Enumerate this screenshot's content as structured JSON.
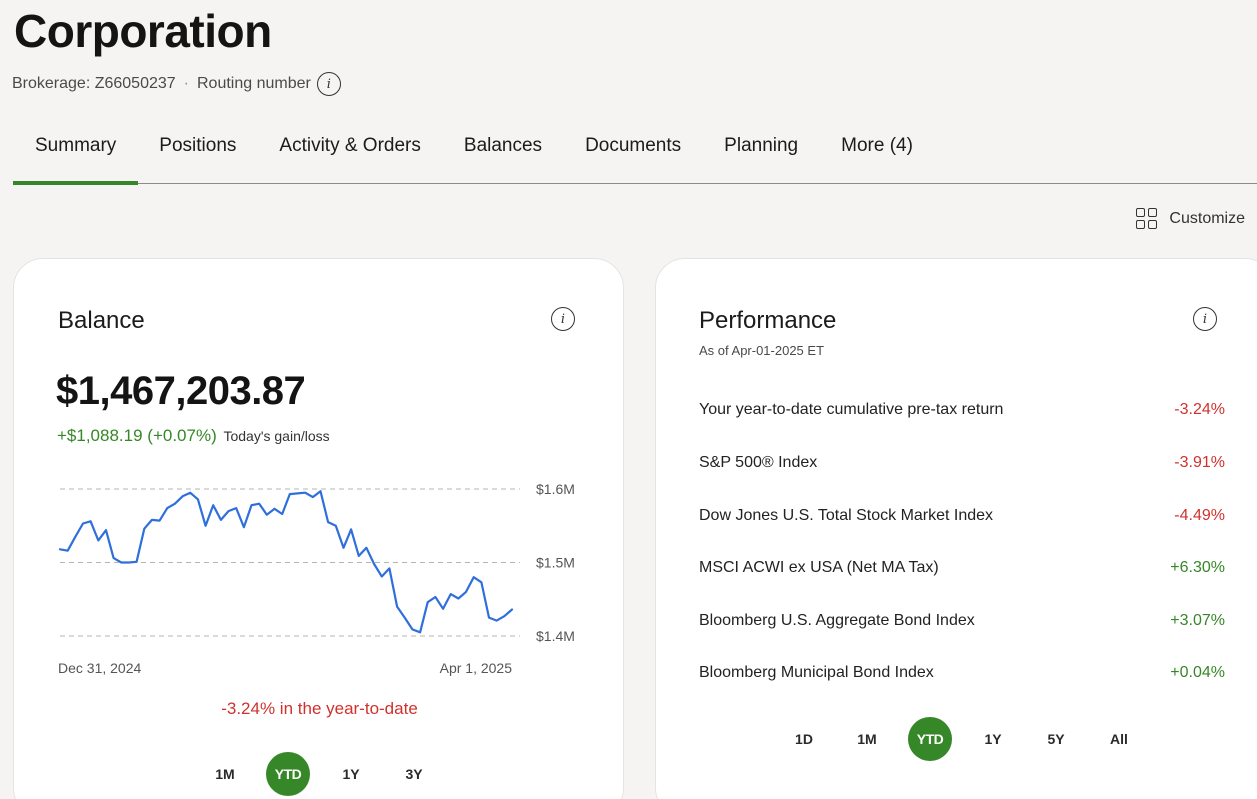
{
  "header": {
    "title": "Corporation",
    "brokerage": "Brokerage: Z66050237",
    "separator": "·",
    "routing": "Routing number"
  },
  "tabs": [
    {
      "label": "Summary",
      "active": true
    },
    {
      "label": "Positions"
    },
    {
      "label": "Activity & Orders"
    },
    {
      "label": "Balances"
    },
    {
      "label": "Documents"
    },
    {
      "label": "Planning"
    },
    {
      "label": "More (4)"
    }
  ],
  "customize": {
    "label": "Customize",
    "icon": "grid-icon"
  },
  "balance": {
    "title": "Balance",
    "value": "$1,467,203.87",
    "gain": "+$1,088.19 (+0.07%)",
    "gain_label": "Today's gain/loss",
    "ytd_text": "-3.24% in the year-to-date",
    "periods": [
      "1M",
      "YTD",
      "1Y",
      "3Y"
    ],
    "active_period": "YTD"
  },
  "performance": {
    "title": "Performance",
    "as_of": "As of Apr-01-2025 ET",
    "rows": [
      {
        "label": "Your year-to-date cumulative pre-tax return",
        "value": "-3.24%",
        "sign": "neg"
      },
      {
        "label": "S&P 500® Index",
        "value": "-3.91%",
        "sign": "neg"
      },
      {
        "label": "Dow Jones U.S. Total Stock Market Index",
        "value": "-4.49%",
        "sign": "neg"
      },
      {
        "label": "MSCI ACWI ex USA (Net MA Tax)",
        "value": "+6.30%",
        "sign": "pos"
      },
      {
        "label": "Bloomberg U.S. Aggregate Bond Index",
        "value": "+3.07%",
        "sign": "pos"
      },
      {
        "label": "Bloomberg Municipal Bond Index",
        "value": "+0.04%",
        "sign": "pos"
      }
    ],
    "periods": [
      "1D",
      "1M",
      "YTD",
      "1Y",
      "5Y",
      "All"
    ],
    "active_period": "YTD"
  },
  "colors": {
    "accent": "#368727",
    "negative": "#d0312d",
    "line": "#2f6fdc"
  },
  "chart_data": {
    "type": "line",
    "x_labels": [
      "Dec 31, 2024",
      "Apr 1, 2025"
    ],
    "y_ticks": [
      "$1.6M",
      "$1.5M",
      "$1.4M"
    ],
    "ylim": [
      1.4,
      1.6
    ],
    "grid": true,
    "series": [
      {
        "values": [
          1.518,
          1.516,
          1.535,
          1.553,
          1.556,
          1.53,
          1.544,
          1.506,
          1.5,
          1.5,
          1.501,
          1.546,
          1.558,
          1.557,
          1.574,
          1.58,
          1.59,
          1.595,
          1.586,
          1.55,
          1.578,
          1.558,
          1.57,
          1.574,
          1.548,
          1.578,
          1.58,
          1.565,
          1.573,
          1.566,
          1.593,
          1.594,
          1.595,
          1.589,
          1.597,
          1.555,
          1.55,
          1.52,
          1.545,
          1.509,
          1.52,
          1.498,
          1.481,
          1.492,
          1.44,
          1.425,
          1.409,
          1.405,
          1.446,
          1.453,
          1.437,
          1.457,
          1.451,
          1.46,
          1.48,
          1.473,
          1.425,
          1.421,
          1.427,
          1.436
        ]
      }
    ]
  }
}
